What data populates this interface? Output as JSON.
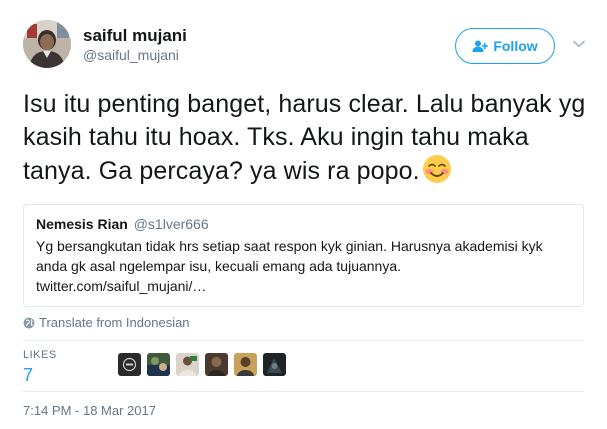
{
  "tweet": {
    "author": {
      "display_name": "saiful mujani",
      "handle": "@saiful_mujani",
      "avatar_icon": "user-avatar"
    },
    "follow_label": "Follow",
    "text": "Isu itu penting banget, harus clear. Lalu banyak yg kasih tahu itu hoax. Tks. Aku ingin tahu maka tanya. Ga percaya? ya wis ra popo.",
    "emoji": "smiling-face-with-blush-emoji",
    "quoted": {
      "display_name": "Nemesis Rian",
      "handle": "@s1lver666",
      "text": "Yg bersangkutan tidak hrs setiap saat respon kyk ginian. Harusnya akademisi kyk anda gk asal ngelempar isu, kecuali emang ada tujuannya.",
      "link": "twitter.com/saiful_mujani/…"
    },
    "translate_label": "Translate from Indonesian",
    "likes": {
      "label": "LIKES",
      "count": "7"
    },
    "timestamp": "7:14 PM - 18 Mar 2017"
  },
  "colors": {
    "accent": "#1da1f2",
    "secondary_text": "#657786",
    "border": "#e1e8ed"
  }
}
